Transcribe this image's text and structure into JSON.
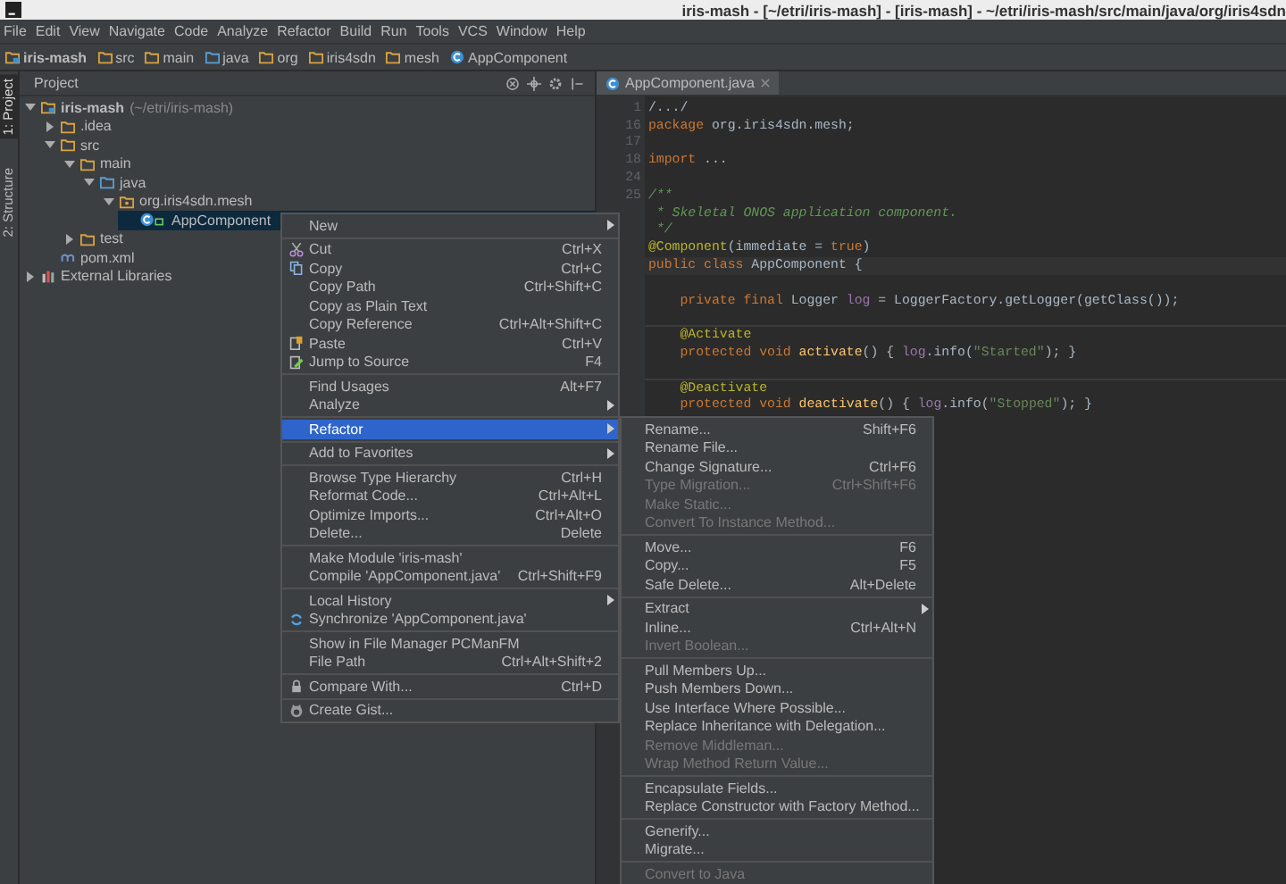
{
  "window": {
    "title": "iris-mash - [~/etri/iris-mash] - [iris-mash] - ~/etri/iris-mash/src/main/java/org/iris4sdn"
  },
  "menubar": [
    "File",
    "Edit",
    "View",
    "Navigate",
    "Code",
    "Analyze",
    "Refactor",
    "Build",
    "Run",
    "Tools",
    "VCS",
    "Window",
    "Help"
  ],
  "breadcrumb": [
    {
      "label": "iris-mash",
      "kind": "module"
    },
    {
      "label": "src",
      "kind": "folder"
    },
    {
      "label": "main",
      "kind": "folder"
    },
    {
      "label": "java",
      "kind": "source"
    },
    {
      "label": "org",
      "kind": "folder"
    },
    {
      "label": "iris4sdn",
      "kind": "folder"
    },
    {
      "label": "mesh",
      "kind": "folder"
    },
    {
      "label": "AppComponent",
      "kind": "class"
    }
  ],
  "tool_strip": [
    {
      "label": "1: Project",
      "selected": true
    },
    {
      "label": "2: Structure",
      "selected": false
    }
  ],
  "project": {
    "title": "Project",
    "tree": [
      {
        "label": "iris-mash",
        "note": "(~/etri/iris-mash)",
        "kind": "module",
        "expanded": true,
        "selected": false,
        "children": [
          {
            "label": ".idea",
            "kind": "folder",
            "expanded": false,
            "selected": false
          },
          {
            "label": "src",
            "kind": "folder",
            "expanded": true,
            "selected": false,
            "children": [
              {
                "label": "main",
                "kind": "folder",
                "expanded": true,
                "selected": false,
                "children": [
                  {
                    "label": "java",
                    "kind": "source",
                    "expanded": true,
                    "selected": false,
                    "children": [
                      {
                        "label": "org.iris4sdn.mesh",
                        "kind": "package",
                        "expanded": true,
                        "selected": false,
                        "children": [
                          {
                            "label": "AppComponent",
                            "kind": "class",
                            "selected": true
                          }
                        ]
                      }
                    ]
                  }
                ]
              },
              {
                "label": "test",
                "kind": "folder",
                "expanded": false,
                "selected": false
              }
            ]
          },
          {
            "label": "pom.xml",
            "kind": "maven",
            "selected": false
          }
        ]
      },
      {
        "label": "External Libraries",
        "kind": "library",
        "expanded": false,
        "selected": false
      }
    ]
  },
  "editor": {
    "tab": "AppComponent.java",
    "lines": [
      {
        "number": "1",
        "tokens": [
          {
            "text": "/.../",
            "kind": "plain"
          }
        ]
      },
      {
        "number": "16",
        "tokens": [
          {
            "text": "package",
            "kind": "keyword"
          },
          {
            "text": " org.iris4sdn.mesh;",
            "kind": "plain"
          }
        ]
      },
      {
        "number": "17"
      },
      {
        "number": "18",
        "tokens": [
          {
            "text": "import",
            "kind": "keyword"
          },
          {
            "text": " ...",
            "kind": "plain"
          }
        ]
      },
      {
        "number": "24"
      },
      {
        "number": "25",
        "tokens": [
          {
            "text": "/**",
            "kind": "doc"
          }
        ]
      },
      {
        "tokens": [
          {
            "text": " * Skeletal ONOS application component.",
            "kind": "doc"
          }
        ]
      },
      {
        "tokens": [
          {
            "text": " */",
            "kind": "doc"
          }
        ]
      },
      {
        "tokens": [
          {
            "text": "@Component",
            "kind": "annotation"
          },
          {
            "text": "(immediate = ",
            "kind": "plain"
          },
          {
            "text": "true",
            "kind": "keyword"
          },
          {
            "text": ")",
            "kind": "plain"
          }
        ]
      },
      {
        "current": true,
        "tokens": [
          {
            "text": "public class ",
            "kind": "keyword"
          },
          {
            "text": "AppComponent {",
            "kind": "plain"
          }
        ]
      },
      {
        "kind": "blank"
      },
      {
        "tokens": [
          {
            "text": "    private final ",
            "kind": "keyword"
          },
          {
            "text": "Logger ",
            "kind": "plain"
          },
          {
            "text": "log",
            "kind": "field"
          },
          {
            "text": " = LoggerFactory.getLogger(getClass());",
            "kind": "plain"
          }
        ]
      },
      {
        "kind": "separator"
      },
      {
        "tokens": [
          {
            "text": "    @Activate",
            "kind": "annotation"
          }
        ]
      },
      {
        "tokens": [
          {
            "text": "    protected void ",
            "kind": "keyword"
          },
          {
            "text": "activate",
            "kind": "method"
          },
          {
            "text": "() { ",
            "kind": "plain"
          },
          {
            "text": "log",
            "kind": "field"
          },
          {
            "text": ".info(",
            "kind": "plain"
          },
          {
            "text": "\"Started\"",
            "kind": "string"
          },
          {
            "text": "); }",
            "kind": "plain"
          }
        ]
      },
      {
        "kind": "separator"
      },
      {
        "tokens": [
          {
            "text": "    @Deactivate",
            "kind": "annotation"
          }
        ]
      },
      {
        "tokens": [
          {
            "text": "    protected void ",
            "kind": "keyword"
          },
          {
            "text": "deactivate",
            "kind": "method"
          },
          {
            "text": "() { ",
            "kind": "plain"
          },
          {
            "text": "log",
            "kind": "field"
          },
          {
            "text": ".info(",
            "kind": "plain"
          },
          {
            "text": "\"Stopped\"",
            "kind": "string"
          },
          {
            "text": "); }",
            "kind": "plain"
          }
        ]
      }
    ]
  },
  "context_menu": [
    [
      {
        "label": "New",
        "submenu": true
      }
    ],
    [
      {
        "label": "Cut",
        "shortcut": "Ctrl+X",
        "kind": "scissors"
      },
      {
        "label": "Copy",
        "shortcut": "Ctrl+C",
        "kind": "copy"
      },
      {
        "label": "Copy Path",
        "shortcut": "Ctrl+Shift+C"
      },
      {
        "label": "Copy as Plain Text"
      },
      {
        "label": "Copy Reference",
        "shortcut": "Ctrl+Alt+Shift+C"
      },
      {
        "label": "Paste",
        "shortcut": "Ctrl+V",
        "kind": "paste"
      },
      {
        "label": "Jump to Source",
        "shortcut": "F4",
        "kind": "jump"
      }
    ],
    [
      {
        "label": "Find Usages",
        "shortcut": "Alt+F7"
      },
      {
        "label": "Analyze",
        "submenu": true
      }
    ],
    [
      {
        "label": "Refactor",
        "submenu": true,
        "selected": true
      }
    ],
    [
      {
        "label": "Add to Favorites",
        "submenu": true
      }
    ],
    [
      {
        "label": "Browse Type Hierarchy",
        "shortcut": "Ctrl+H"
      },
      {
        "label": "Reformat Code...",
        "shortcut": "Ctrl+Alt+L"
      },
      {
        "label": "Optimize Imports...",
        "shortcut": "Ctrl+Alt+O"
      },
      {
        "label": "Delete...",
        "shortcut": "Delete"
      }
    ],
    [
      {
        "label": "Make Module 'iris-mash'"
      },
      {
        "label": "Compile 'AppComponent.java'",
        "shortcut": "Ctrl+Shift+F9"
      }
    ],
    [
      {
        "label": "Local History",
        "submenu": true
      },
      {
        "label": "Synchronize 'AppComponent.java'",
        "kind": "sync"
      }
    ],
    [
      {
        "label": "Show in File Manager PCManFM"
      },
      {
        "label": "File Path",
        "shortcut": "Ctrl+Alt+Shift+2"
      }
    ],
    [
      {
        "label": "Compare With...",
        "shortcut": "Ctrl+D",
        "kind": "compare"
      }
    ],
    [
      {
        "label": "Create Gist...",
        "kind": "gist"
      }
    ]
  ],
  "refactor_menu": [
    [
      {
        "label": "Rename...",
        "shortcut": "Shift+F6",
        "disabled": false
      },
      {
        "label": "Rename File...",
        "disabled": false
      },
      {
        "label": "Change Signature...",
        "shortcut": "Ctrl+F6",
        "disabled": false
      },
      {
        "label": "Type Migration...",
        "shortcut": "Ctrl+Shift+F6",
        "disabled": true
      },
      {
        "label": "Make Static...",
        "disabled": true
      },
      {
        "label": "Convert To Instance Method...",
        "disabled": true
      }
    ],
    [
      {
        "label": "Move...",
        "shortcut": "F6",
        "disabled": false
      },
      {
        "label": "Copy...",
        "shortcut": "F5",
        "disabled": false
      },
      {
        "label": "Safe Delete...",
        "shortcut": "Alt+Delete",
        "disabled": false
      }
    ],
    [
      {
        "label": "Extract",
        "submenu": true,
        "disabled": false
      },
      {
        "label": "Inline...",
        "shortcut": "Ctrl+Alt+N",
        "disabled": false
      },
      {
        "label": "Invert Boolean...",
        "disabled": true
      }
    ],
    [
      {
        "label": "Pull Members Up...",
        "disabled": false
      },
      {
        "label": "Push Members Down...",
        "disabled": false
      },
      {
        "label": "Use Interface Where Possible...",
        "disabled": false
      },
      {
        "label": "Replace Inheritance with Delegation...",
        "disabled": false
      },
      {
        "label": "Remove Middleman...",
        "disabled": true
      },
      {
        "label": "Wrap Method Return Value...",
        "disabled": true
      }
    ],
    [
      {
        "label": "Encapsulate Fields...",
        "disabled": false
      },
      {
        "label": "Replace Constructor with Factory Method...",
        "disabled": false
      }
    ],
    [
      {
        "label": "Generify...",
        "disabled": false
      },
      {
        "label": "Migrate...",
        "disabled": false
      }
    ],
    [
      {
        "label": "Convert to Java",
        "disabled": true
      }
    ]
  ]
}
